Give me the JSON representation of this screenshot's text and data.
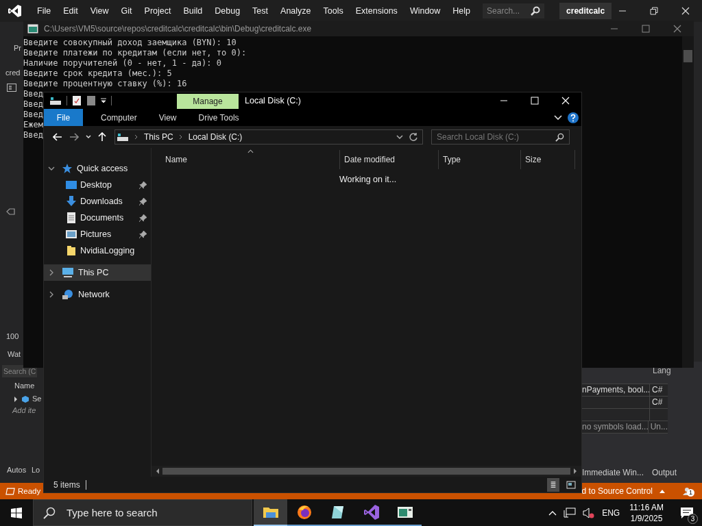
{
  "ide": {
    "menu": [
      "File",
      "Edit",
      "View",
      "Git",
      "Project",
      "Build",
      "Debug",
      "Test",
      "Analyze",
      "Tools",
      "Extensions",
      "Window",
      "Help"
    ],
    "search_placeholder": "Search...",
    "solution_name": "creditcalc",
    "left_panel": {
      "toolbar_text": "Pr",
      "tab_text": "cred",
      "zoom": "100",
      "watch_tab": "Wat",
      "watch_search_placeholder": "Search (C",
      "watch_column": "Name",
      "watch_row": "Se",
      "watch_add": "Add ite",
      "bottom_tabs": [
        "Autos",
        "Lo"
      ]
    },
    "right_panel": {
      "column": "Lang",
      "rows": [
        {
          "column_1": "nPayments, bool...",
          "lang": "C#"
        },
        {
          "lang": "C#"
        },
        {},
        {
          "column_1": "no symbols load...",
          "lang": "Un..."
        }
      ],
      "bottom_tabs": [
        "Immediate Win...",
        "Output"
      ]
    },
    "status": {
      "text": "Ready",
      "source_control": "d to Source Control",
      "notifications": "1"
    }
  },
  "console": {
    "title": "C:\\Users\\VM5\\source\\repos\\creditcalc\\creditcalc\\bin\\Debug\\creditcalc.exe",
    "lines": [
      "Введите совокупный доход заемщика (BYN): 10",
      "Введите платежи по кредитам (если нет, то 0):",
      "Наличие поручителей (0 - нет, 1 - да): 0",
      "Введите срок кредита (мес.): 5",
      "Введите процентную ставку (%): 16",
      "Введ",
      "Введ",
      "Введ",
      "Ежем",
      "Введ"
    ]
  },
  "explorer": {
    "title": "Local Disk (C:)",
    "context_tab": "Manage",
    "ribbon_tabs": [
      {
        "label": "File",
        "kind": "file"
      },
      {
        "label": "Computer",
        "kind": "tab"
      },
      {
        "label": "View",
        "kind": "tab"
      },
      {
        "label": "Drive Tools",
        "kind": "tab"
      }
    ],
    "breadcrumb": [
      "This PC",
      "Local Disk (C:)"
    ],
    "search_placeholder": "Search Local Disk (C:)",
    "nav": [
      {
        "label": "Quick access",
        "kind": "star",
        "expanded": true,
        "selected": false,
        "children": [
          {
            "label": "Desktop",
            "kind": "desktop",
            "pinned": true,
            "selected": false
          },
          {
            "label": "Downloads",
            "kind": "downloads",
            "pinned": true,
            "selected": false
          },
          {
            "label": "Documents",
            "kind": "documents",
            "pinned": true,
            "selected": false
          },
          {
            "label": "Pictures",
            "kind": "pictures",
            "pinned": true,
            "selected": false
          },
          {
            "label": "NvidiaLogging",
            "kind": "folder",
            "pinned": false,
            "selected": false
          }
        ]
      },
      {
        "label": "This PC",
        "kind": "pc",
        "expanded": false,
        "selected": true
      },
      {
        "label": "Network",
        "kind": "network",
        "expanded": false,
        "selected": false
      }
    ],
    "columns": [
      {
        "label": "Name",
        "sorted": true
      },
      {
        "label": "Date modified",
        "sorted": false
      },
      {
        "label": "Type",
        "sorted": false
      },
      {
        "label": "Size",
        "sorted": false
      }
    ],
    "message": "Working on it...",
    "status": "5 items",
    "view_buttons": [
      {
        "kind": "details",
        "selected": true
      },
      {
        "kind": "tiles",
        "selected": false
      }
    ]
  },
  "taskbar": {
    "search_placeholder": "Type here to search",
    "apps": [
      {
        "kind": "explorer",
        "selected": true
      },
      {
        "kind": "browser",
        "selected": false
      },
      {
        "kind": "notes",
        "selected": false
      },
      {
        "kind": "ide",
        "selected": false
      },
      {
        "kind": "window",
        "selected": false
      }
    ],
    "language": "ENG",
    "time": "11:16 AM",
    "date": "1/9/2025",
    "notifications": "3"
  }
}
